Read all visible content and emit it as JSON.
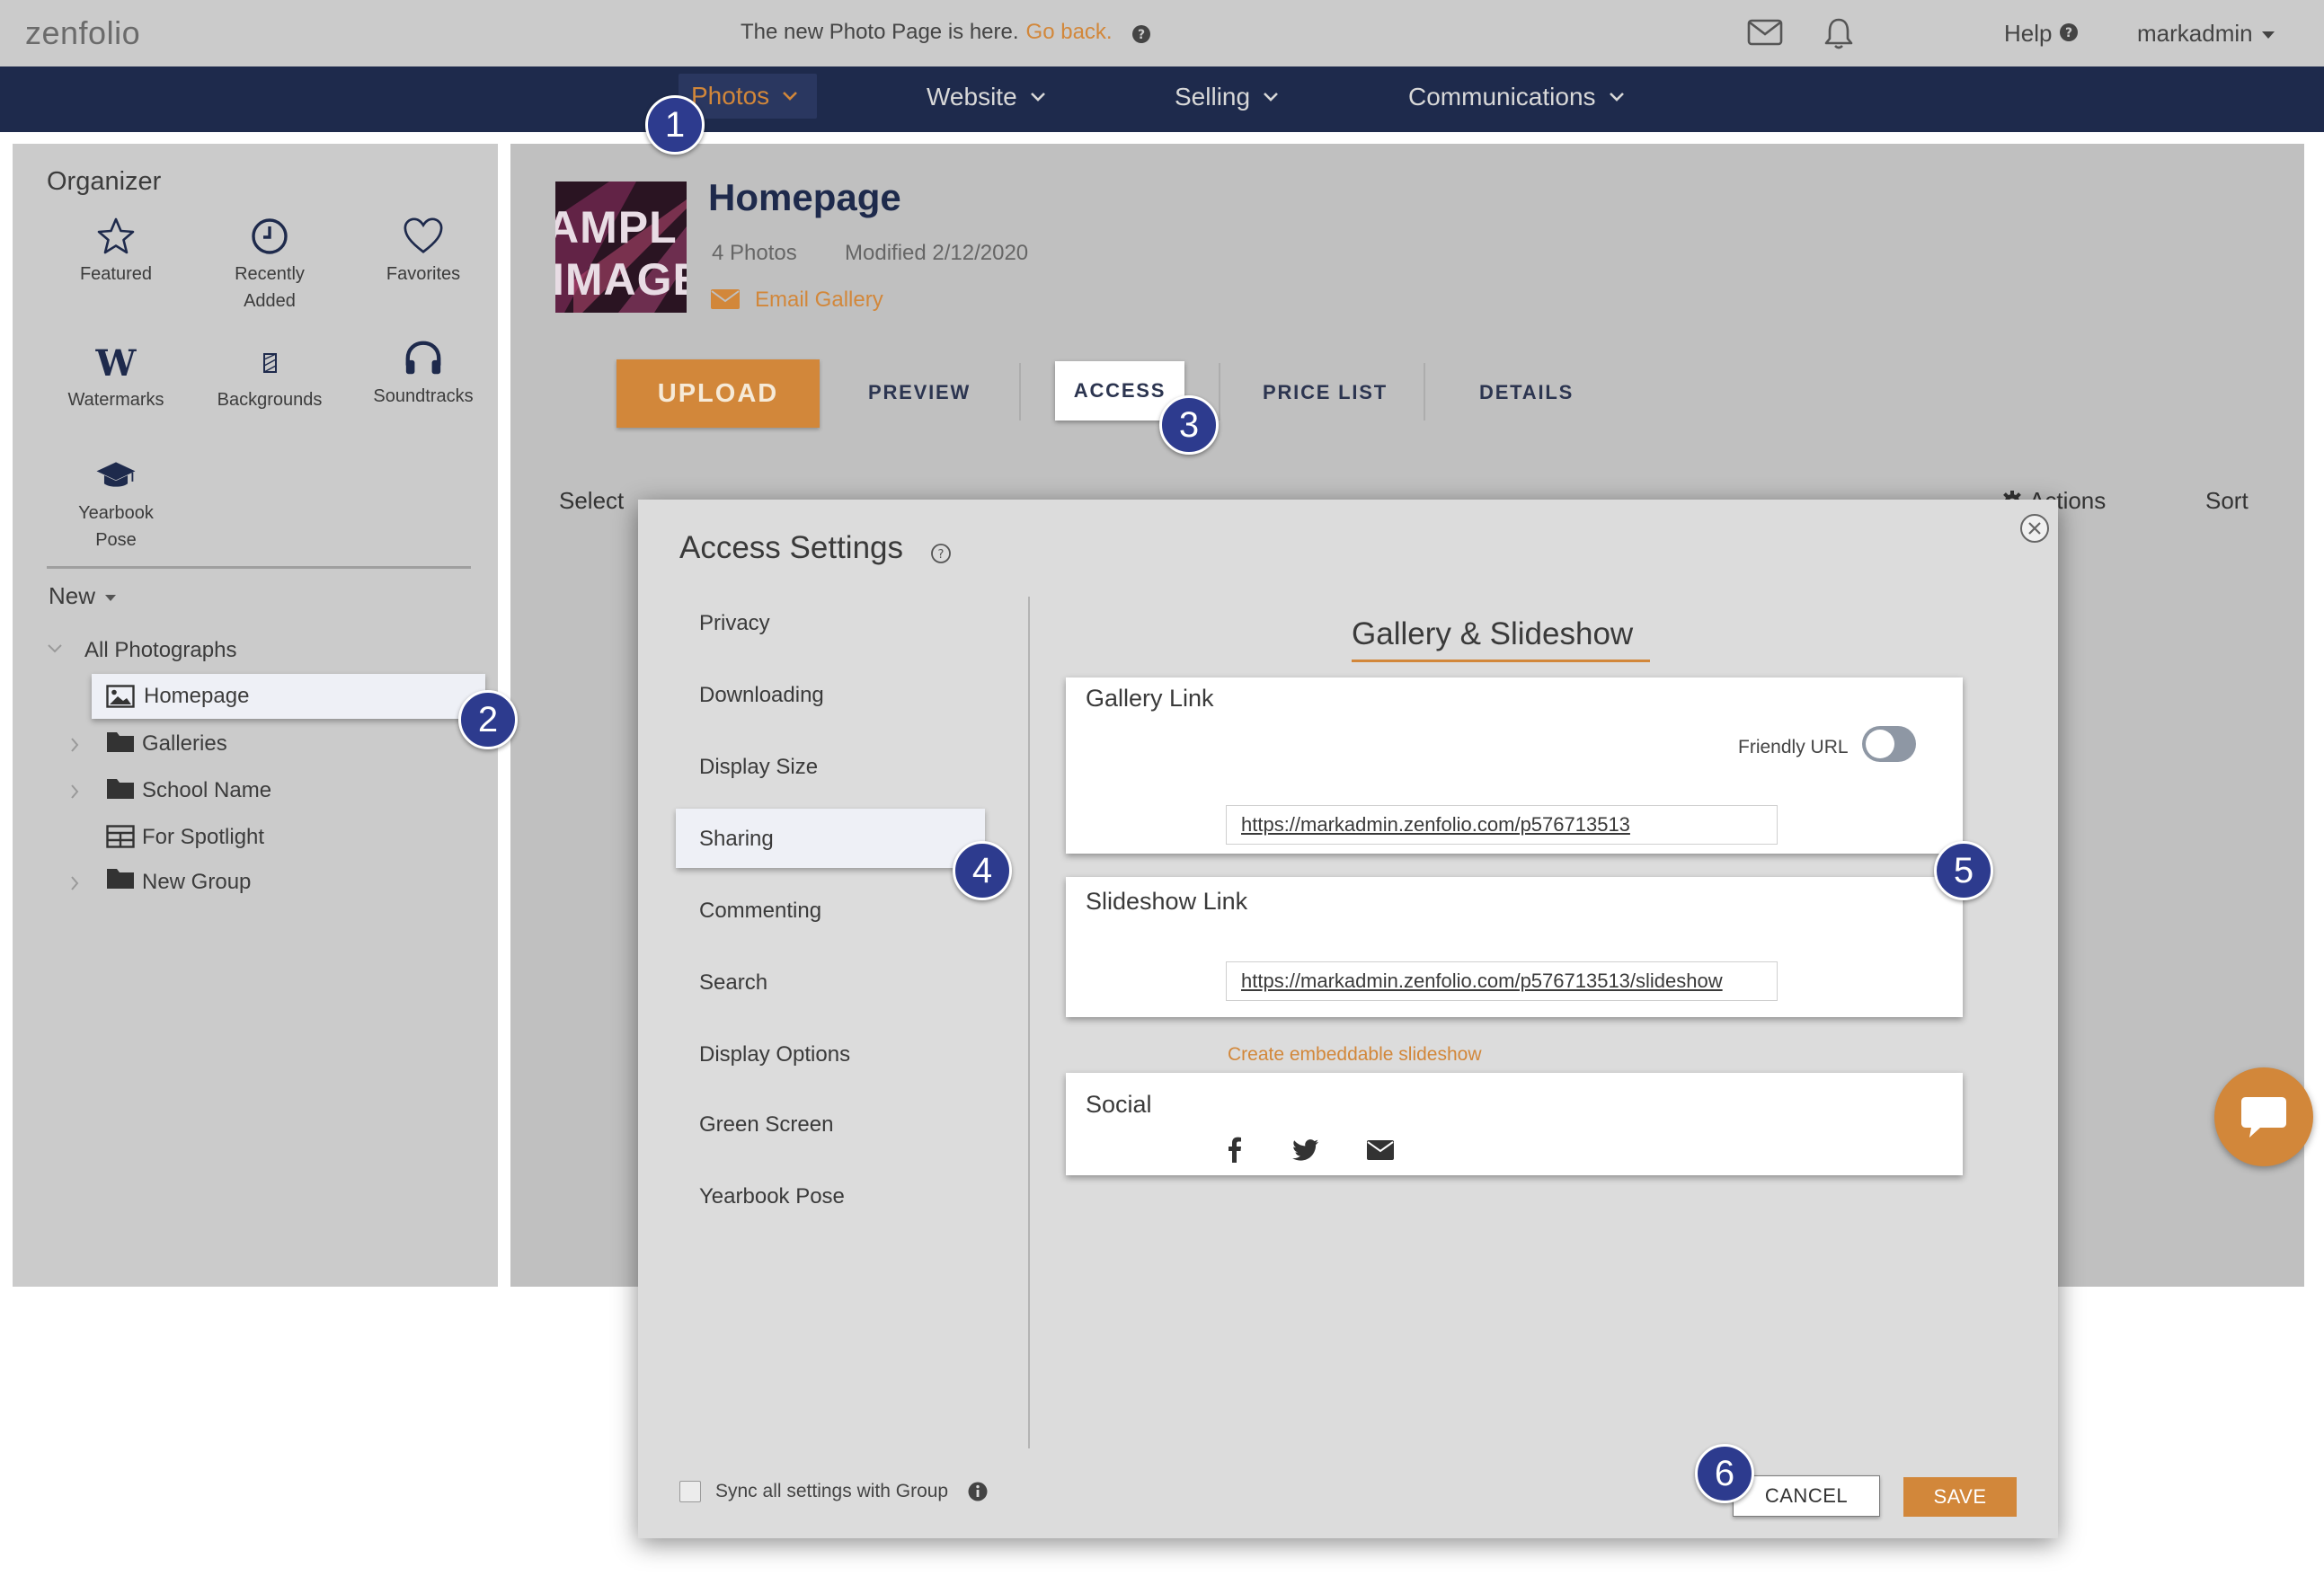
{
  "topbar": {
    "logo": "zenfolio",
    "notice_text": "The new Photo Page is here.",
    "notice_link": "Go back.",
    "help": "Help",
    "user": "markadmin"
  },
  "nav": {
    "items": [
      {
        "label": "Photos",
        "active": true
      },
      {
        "label": "Website"
      },
      {
        "label": "Selling"
      },
      {
        "label": "Communications"
      }
    ]
  },
  "organizer": {
    "title": "Organizer",
    "tools": [
      {
        "label": "Featured",
        "icon": "star-icon"
      },
      {
        "label": "Recently Added",
        "icon": "clock-icon"
      },
      {
        "label": "Favorites",
        "icon": "heart-icon"
      },
      {
        "label": "Watermarks",
        "icon": "watermark-w-icon"
      },
      {
        "label": "Backgrounds",
        "icon": "background-icon"
      },
      {
        "label": "Soundtracks",
        "icon": "headphones-icon"
      },
      {
        "label": "Yearbook Pose",
        "icon": "graduation-cap-icon"
      }
    ],
    "new_label": "New",
    "tree": {
      "root": "All Photographs",
      "items": [
        "Homepage",
        "Galleries",
        "School Name",
        "For Spotlight",
        "New Group"
      ]
    }
  },
  "gallery": {
    "thumb_lines": [
      "AMPL",
      "IMAGE"
    ],
    "title": "Homepage",
    "photo_count": "4 Photos",
    "modified": "Modified 2/12/2020",
    "email_link": "Email Gallery"
  },
  "toolbar": {
    "upload": "UPLOAD",
    "tabs": [
      "PREVIEW",
      "ACCESS",
      "PRICE LIST",
      "DETAILS"
    ],
    "select_label": "Select",
    "actions": "Actions",
    "sort": "Sort"
  },
  "modal": {
    "title": "Access Settings",
    "nav": [
      "Privacy",
      "Downloading",
      "Display Size",
      "Sharing",
      "Commenting",
      "Search",
      "Display Options",
      "Green Screen",
      "Yearbook Pose"
    ],
    "active_nav": "Sharing",
    "section_title": "Gallery & Slideshow",
    "gallery_link": {
      "title": "Gallery Link",
      "friendly_label": "Friendly URL",
      "friendly_on": false,
      "url": "https://markadmin.zenfolio.com/p576713513"
    },
    "slideshow_link": {
      "title": "Slideshow Link",
      "url": "https://markadmin.zenfolio.com/p576713513/slideshow"
    },
    "embed_link": "Create embeddable slideshow",
    "social": {
      "title": "Social",
      "icons": [
        "facebook-icon",
        "twitter-icon",
        "email-icon"
      ]
    },
    "sync_label": "Sync all settings with Group",
    "cancel": "CANCEL",
    "save": "SAVE"
  },
  "callouts": [
    "1",
    "2",
    "3",
    "4",
    "5",
    "6"
  ],
  "colors": {
    "accent": "#d2873a",
    "navy": "#1e2a4c",
    "callout": "#2d3b8e"
  }
}
